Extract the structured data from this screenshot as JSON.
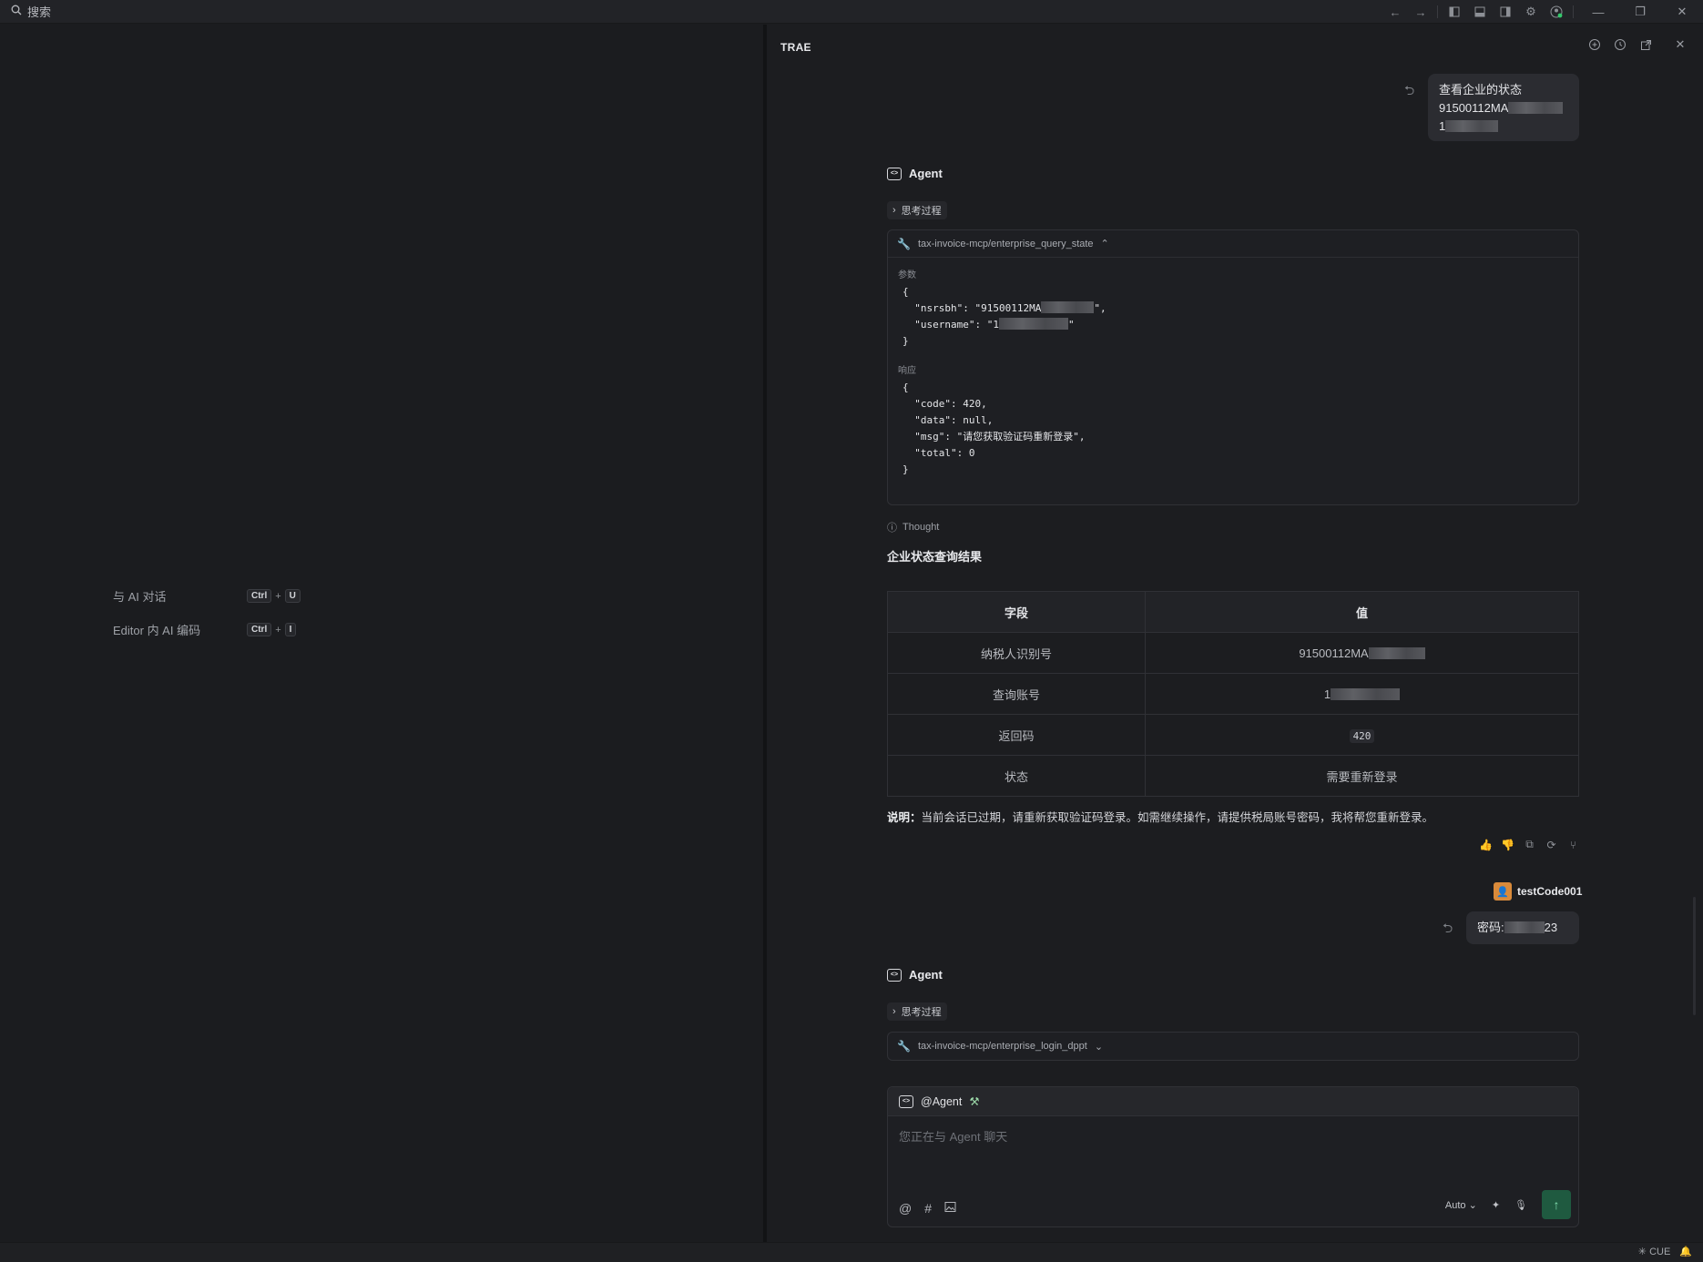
{
  "titlebar": {
    "search_label": "搜索"
  },
  "shortcuts": [
    {
      "label": "与 AI 对话",
      "key1": "Ctrl",
      "key2": "U"
    },
    {
      "label": "Editor 内 AI 编码",
      "key1": "Ctrl",
      "key2": "I"
    }
  ],
  "panel": {
    "title": "TRAE"
  },
  "messages": {
    "user1": {
      "line1": "查看企业的状态",
      "line2_prefix": "91500112MA",
      "line3_prefix": "1"
    },
    "agent_label": "Agent",
    "think_label": "思考过程",
    "tool1": {
      "name": "tax-invoice-mcp/enterprise_query_state",
      "params_label": "参数",
      "params_open": "{",
      "param1": "  \"nsrsbh\": \"91500112MA",
      "param1_end": "\",",
      "param2": "  \"username\": \"1",
      "param2_end": "\"",
      "params_close": "}",
      "response_label": "响应",
      "response_code": "{\n  \"code\": 420,\n  \"data\": null,\n  \"msg\": \"请您获取验证码重新登录\",\n  \"total\": 0\n}"
    },
    "thought_label": "Thought",
    "result_title": "企业状态查询结果",
    "table": {
      "headers": [
        "字段",
        "值"
      ],
      "rows": [
        {
          "field": "纳税人识别号",
          "value": "91500112MA"
        },
        {
          "field": "查询账号",
          "value": "1"
        },
        {
          "field": "返回码",
          "value": "420"
        },
        {
          "field": "状态",
          "value": "需要重新登录"
        }
      ]
    },
    "note_bold": "说明：",
    "note_text": "当前会话已过期，请重新获取验证码登录。如需继续操作，请提供税局账号密码，我将帮您重新登录。",
    "user_name": "testCode001",
    "user2_prefix": "密码:",
    "user2_suffix": "23",
    "tool2": {
      "name": "tax-invoice-mcp/enterprise_login_dppt"
    }
  },
  "input": {
    "mention": "@Agent",
    "placeholder": "您正在与 Agent 聊天",
    "mode": "Auto"
  },
  "statusbar": {
    "cue": "CUE"
  }
}
